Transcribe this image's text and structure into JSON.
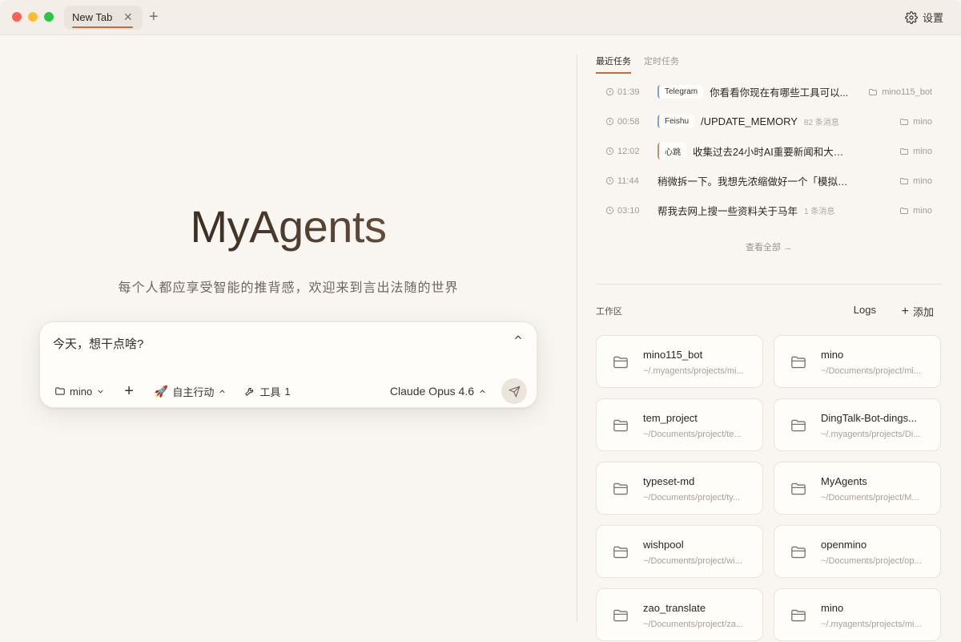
{
  "tabs": [
    {
      "label": "New Tab"
    }
  ],
  "titlebar": {
    "settings_label": "设置"
  },
  "hero": {
    "title": "MyAgents",
    "subtitle": "每个人都应享受智能的推背感，欢迎来到言出法随的世界"
  },
  "composer": {
    "placeholder": "今天，想干点啥?",
    "project": "mino",
    "mode": "自主行动",
    "tools_label": "工具",
    "tools_count": "1",
    "model": "Claude Opus 4.6"
  },
  "recent": {
    "tabs": [
      "最近任务",
      "定时任务"
    ],
    "items": [
      {
        "time": "01:39",
        "badge": "Telegram",
        "text": "你看看你现在有哪些工具可以...",
        "count": "",
        "project": "mino115_bot"
      },
      {
        "time": "00:58",
        "badge": "Feishu",
        "text": "/UPDATE_MEMORY",
        "count": "82 条消息",
        "project": "mino"
      },
      {
        "time": "12:02",
        "badge": "心跳",
        "text": "收集过去24小时AI重要新闻和大佬发言,...",
        "count": "",
        "project": "mino"
      },
      {
        "time": "11:44",
        "badge": "",
        "text": "稍微拆一下。我想先浓缩做好一个「模拟面试」的...",
        "count": "",
        "project": "mino"
      },
      {
        "time": "03:10",
        "badge": "",
        "text": "帮我去网上搜一些资料关于马年",
        "count": "1 条消息",
        "project": "mino"
      }
    ],
    "view_all": "查看全部 →"
  },
  "workspace": {
    "title": "工作区",
    "logs": "Logs",
    "add": "添加",
    "projects": [
      {
        "name": "mino115_bot",
        "path": "~/.myagents/projects/mi..."
      },
      {
        "name": "mino",
        "path": "~/Documents/project/mi..."
      },
      {
        "name": "tem_project",
        "path": "~/Documents/project/te..."
      },
      {
        "name": "DingTalk-Bot-dings...",
        "path": "~/.myagents/projects/Di..."
      },
      {
        "name": "typeset-md",
        "path": "~/Documents/project/ty..."
      },
      {
        "name": "MyAgents",
        "path": "~/Documents/project/M..."
      },
      {
        "name": "wishpool",
        "path": "~/Documents/project/wi..."
      },
      {
        "name": "openmino",
        "path": "~/Documents/project/op..."
      },
      {
        "name": "zao_translate",
        "path": "~/Documents/project/za..."
      },
      {
        "name": "mino",
        "path": "~/.myagents/projects/mi..."
      }
    ]
  },
  "colors": {
    "accent": "#c66a3d",
    "background": "#f9f6f1"
  }
}
